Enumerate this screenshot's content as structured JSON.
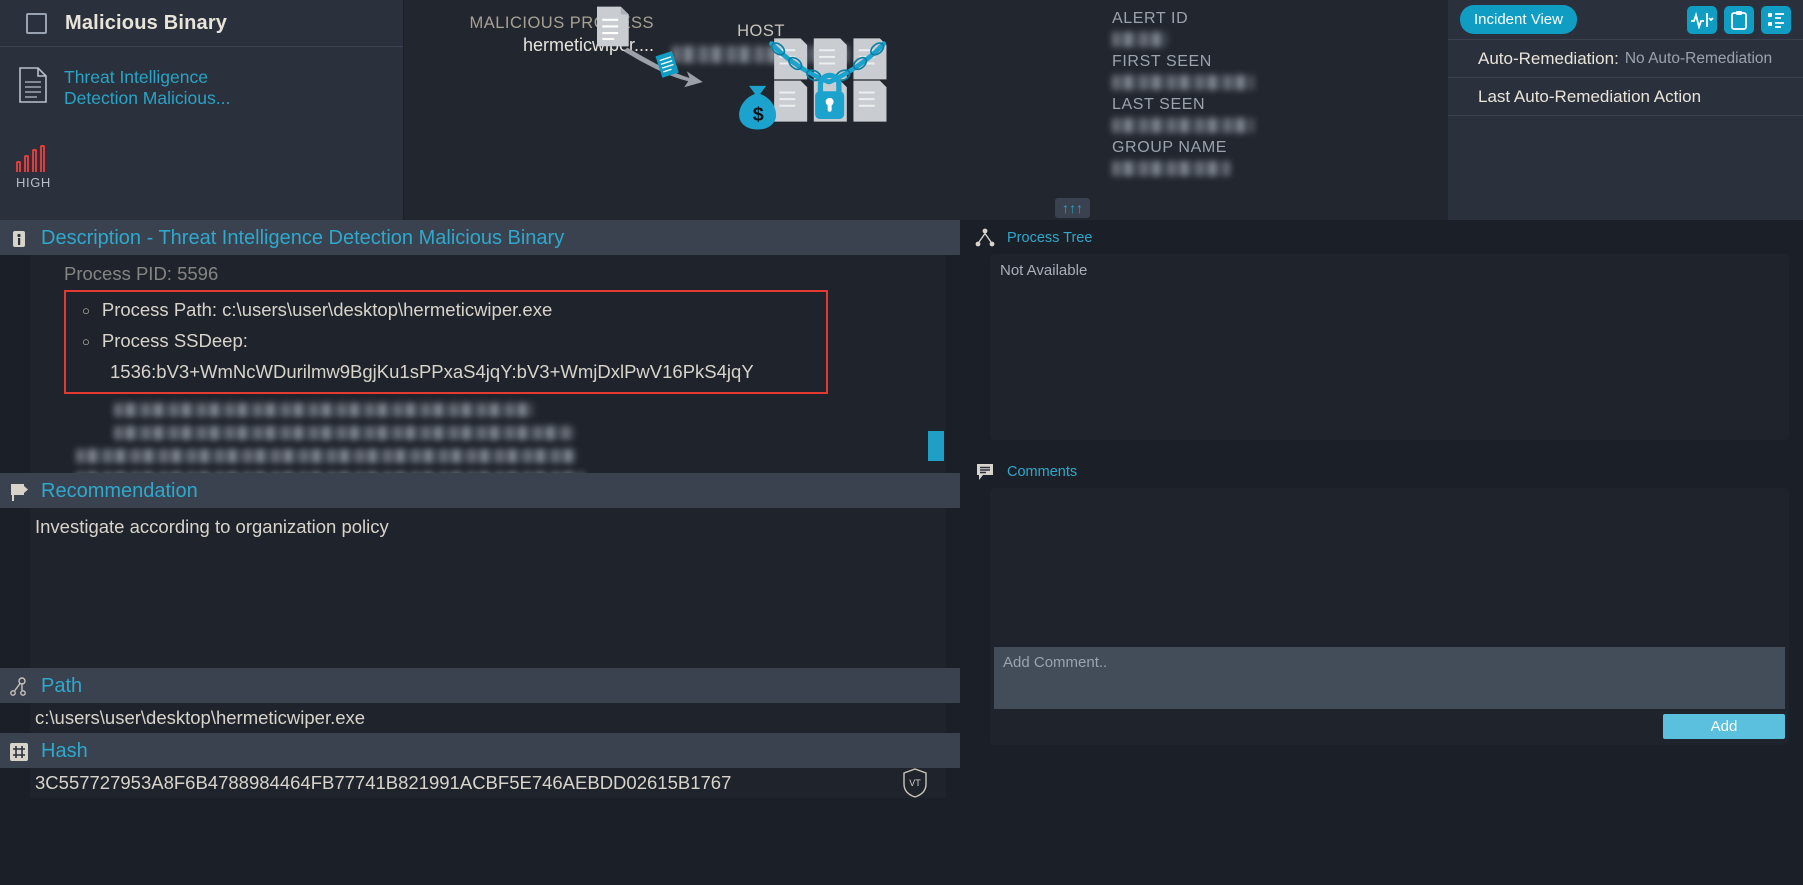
{
  "theme": {
    "accent": "#0f9dc4",
    "link": "#2fa8cc",
    "severity": "#e03c3c",
    "highlight": "#e23a33",
    "panel_bg": "#1f232b",
    "bar_bg": "#2b313c"
  },
  "header": {
    "alert_title": "Malicious Binary",
    "rule_name": "Threat Intelligence Detection Malicious...",
    "severity_label": "HIGH",
    "checkbox_icon": "checkbox-icon",
    "rule_icon": "document-icon",
    "severity_icon": "severity-bars-icon"
  },
  "graphic": {
    "malicious_process_caption": "MALICIOUS PROCESS",
    "malicious_process_name": "hermeticwiper....",
    "host_caption": "HOST",
    "host_value": "",
    "scroll_up_icon": "triple-up-arrow-icon",
    "scroll_up_glyphs": "↑↑↑"
  },
  "meta": {
    "alert_id_label": "ALERT ID",
    "alert_id_value": "",
    "first_seen_label": "FIRST SEEN",
    "first_seen_value": "",
    "last_seen_label": "LAST SEEN",
    "last_seen_value": "",
    "group_name_label": "GROUP NAME",
    "group_name_value": ""
  },
  "actions": {
    "incident_view_label": "Incident View",
    "pulse_icon": "activity-pulse-dropdown-icon",
    "clipboard_icon": "clipboard-icon",
    "list_icon": "list-details-icon",
    "auto_remediation_label": "Auto-Remediation:",
    "auto_remediation_value": "No Auto-Remediation",
    "last_auto_remediation_label": "Last Auto-Remediation Action"
  },
  "description": {
    "icon": "info-icon",
    "title": "Description - Threat Intelligence Detection Malicious Binary",
    "clipped_line": "Process PID: 5596",
    "bullet_marker": "○",
    "items": [
      {
        "label": "Process Path: c:\\users\\user\\desktop\\hermeticwiper.exe"
      },
      {
        "label": "Process SSDeep:"
      }
    ],
    "ssdeep_value": "1536:bV3+WmNcWDurilmw9BgjKu1sPPxaS4jqY:bV3+WmjDxlPwV16PkS4jqY"
  },
  "recommendation": {
    "icon": "recommendation-flag-icon",
    "title": "Recommendation",
    "text": "Investigate according to organization policy"
  },
  "path": {
    "icon": "path-node-icon",
    "title": "Path",
    "value": "c:\\users\\user\\desktop\\hermeticwiper.exe"
  },
  "hash": {
    "icon": "hash-icon",
    "title": "Hash",
    "value": "3C557727953A8F6B4788984464FB77741B821991ACBF5E746AEBDD02615B1767",
    "vt_badge_icon": "virustotal-shield-icon",
    "vt_badge_label": "VT"
  },
  "process_tree": {
    "icon": "process-tree-icon",
    "title": "Process Tree",
    "content": "Not Available"
  },
  "comments": {
    "icon": "comments-icon",
    "title": "Comments",
    "input_value": "",
    "input_placeholder": "Add Comment..",
    "add_label": "Add"
  }
}
